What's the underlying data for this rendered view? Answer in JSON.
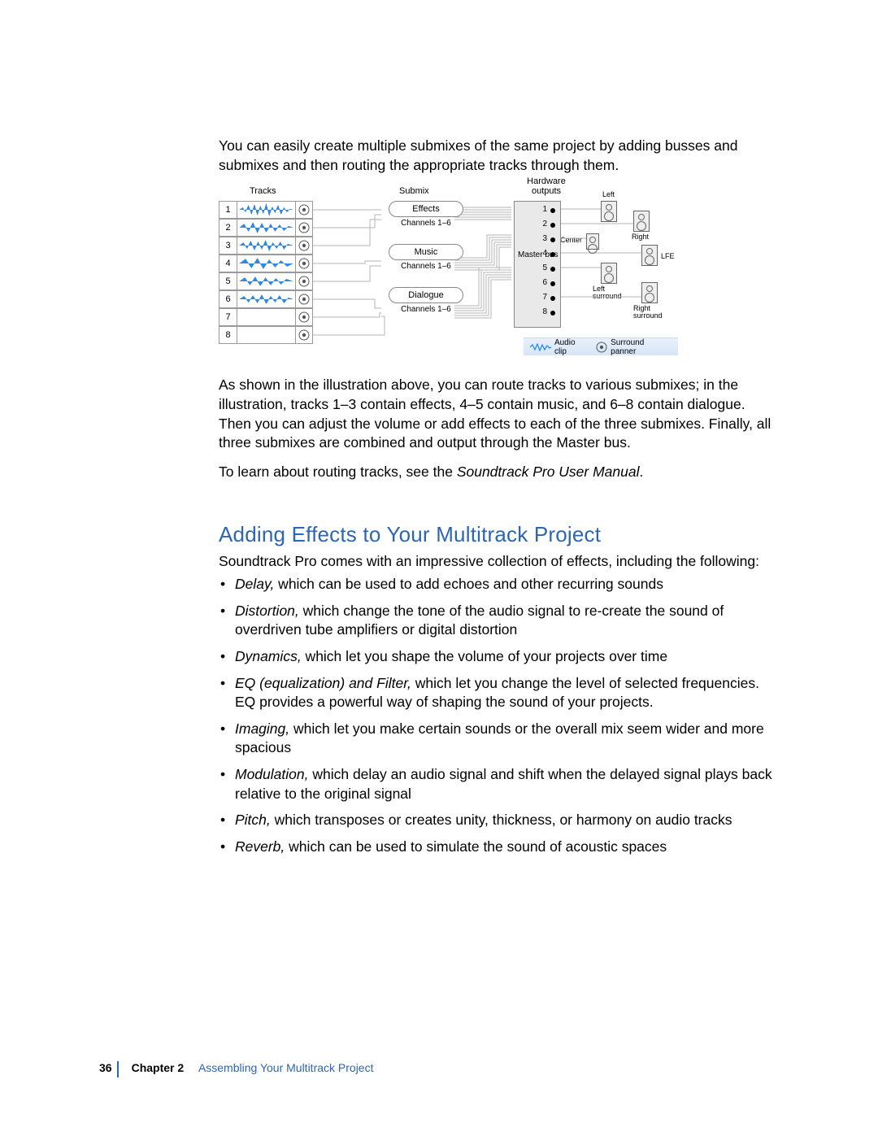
{
  "intro_paragraph": "You can easily create multiple submixes of the same project by adding busses and submixes and then routing the appropriate tracks through them.",
  "diagram": {
    "column_headers": {
      "tracks": "Tracks",
      "submix": "Submix",
      "hardware": "Hardware outputs"
    },
    "track_numbers": [
      "1",
      "2",
      "3",
      "4",
      "5",
      "6",
      "7",
      "8"
    ],
    "waveform_tracks": [
      1,
      2,
      3,
      4,
      5,
      6
    ],
    "submixes": [
      {
        "name": "Effects",
        "channels": "Channels 1–6"
      },
      {
        "name": "Music",
        "channels": "Channels 1–6"
      },
      {
        "name": "Dialogue",
        "channels": "Channels 1–6"
      }
    ],
    "master_bus_label": "Master bus",
    "hardware_outputs": [
      "1",
      "2",
      "3",
      "4",
      "5",
      "6",
      "7",
      "8"
    ],
    "speakers": {
      "left": "Left",
      "right": "Right",
      "center": "Center",
      "lfe": "LFE",
      "left_surround": "Left surround",
      "right_surround": "Right surround"
    },
    "legend": {
      "audio_clip": "Audio clip",
      "surround_panner": "Surround panner"
    }
  },
  "illustration_paragraph": "As shown in the illustration above, you can route tracks to various submixes; in the illustration, tracks 1–3 contain effects, 4–5 contain music, and 6–8 contain dialogue. Then you can adjust the volume or add effects to each of the three submixes. Finally, all three submixes are combined and output through the Master bus.",
  "routing_reference_prefix": "To learn about routing tracks, see the ",
  "routing_reference_title": "Soundtrack Pro User Manual",
  "routing_reference_suffix": ".",
  "section_heading": "Adding Effects to Your Multitrack Project",
  "effects_intro": "Soundtrack Pro comes with an impressive collection of effects, including the following:",
  "effects": [
    {
      "name": "Delay,",
      "desc": " which can be used to add echoes and other recurring sounds"
    },
    {
      "name": "Distortion,",
      "desc": " which change the tone of the audio signal to re-create the sound of overdriven tube amplifiers or digital distortion"
    },
    {
      "name": "Dynamics,",
      "desc": " which let you shape the volume of your projects over time"
    },
    {
      "name": "EQ (equalization) and Filter,",
      "desc": " which let you change the level of selected frequencies. EQ provides a powerful way of shaping the sound of your projects."
    },
    {
      "name": "Imaging,",
      "desc": " which let you make certain sounds or the overall mix seem wider and more spacious"
    },
    {
      "name": "Modulation,",
      "desc": " which delay an audio signal and shift when the delayed signal plays back relative to the original signal"
    },
    {
      "name": "Pitch,",
      "desc": " which transposes or creates unity, thickness, or harmony on audio tracks"
    },
    {
      "name": "Reverb,",
      "desc": " which can be used to simulate the sound of acoustic spaces"
    }
  ],
  "footer": {
    "page_number": "36",
    "chapter_label": "Chapter 2",
    "chapter_title": "Assembling Your Multitrack Project"
  }
}
